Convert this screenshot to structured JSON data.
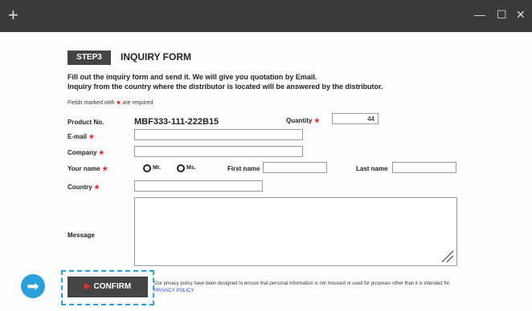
{
  "window": {
    "new_tab_symbol": "+",
    "minimize_symbol": "—",
    "maximize_symbol": "☐",
    "close_symbol": "✕"
  },
  "form": {
    "step_badge": "STEP3",
    "title": "INQUIRY FORM",
    "intro_line1": "Fill out the inquiry form and send it. We will give you quotation by Email.",
    "intro_line2": "Inquiry from the country where the distributor is located will be answered by the distributor.",
    "required_note_prefix": "Fields marked with",
    "required_note_suffix": "are required",
    "required_marker": "★",
    "product_no_label": "Product No.",
    "product_no_value": "MBF333-111-222B15",
    "quantity_label": "Quantity",
    "quantity_value": "44",
    "email_label": "E-mail",
    "company_label": "Company",
    "your_name_label": "Your name",
    "title_mr": "Mr.",
    "title_ms": "Ms.",
    "first_name_label": "First name",
    "last_name_label": "Last name",
    "country_label": "Country",
    "message_label": "Message",
    "confirm_label": "CONFIRM",
    "confirm_arrow": "▶",
    "nav_arrow": "➡",
    "policy_text": "Our privacy policy have been designed to ensure that personal information is not misused or used for purposes other than it is intended for.",
    "policy_link": "PRIVACY POLICY"
  },
  "colors": {
    "required_star": "#e0312e",
    "highlight": "#2a9fd8",
    "button_bg": "#444444"
  }
}
